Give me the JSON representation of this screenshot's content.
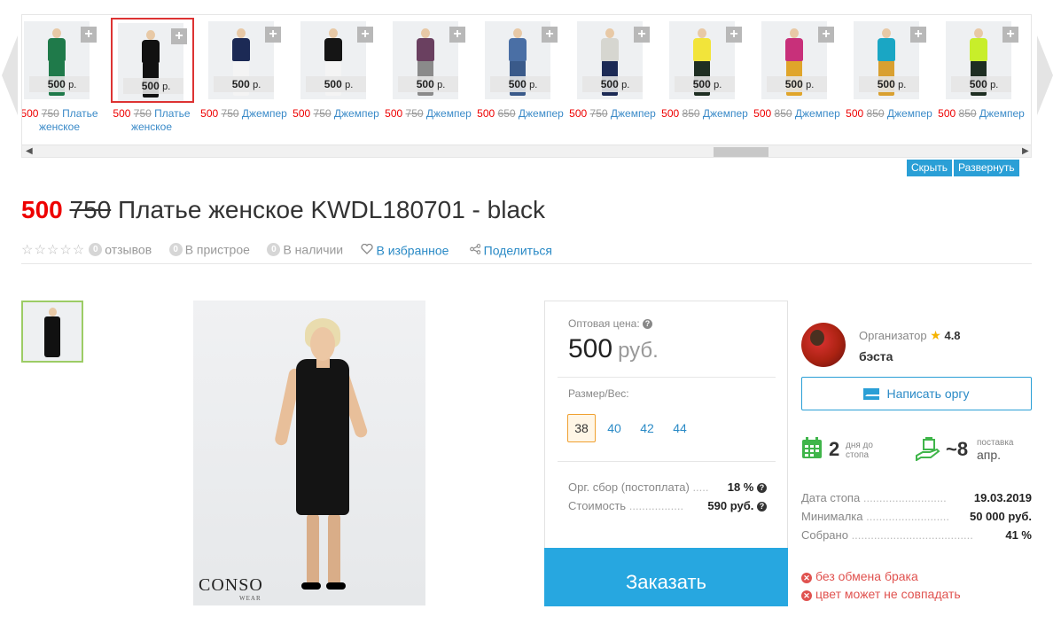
{
  "carousel": {
    "items": [
      {
        "price_tag": "500",
        "currency": "р.",
        "price_now": "500",
        "price_old": "750",
        "name": "Платье женское",
        "top_color": "#1f7a4a",
        "bottom_color": "#1f7a4a",
        "selected": false
      },
      {
        "price_tag": "500",
        "currency": "р.",
        "price_now": "500",
        "price_old": "750",
        "name": "Платье женское",
        "top_color": "#111111",
        "bottom_color": "#111111",
        "selected": true
      },
      {
        "price_tag": "500",
        "currency": "р.",
        "price_now": "500",
        "price_old": "750",
        "name": "Джемпер",
        "top_color": "#1c2a55",
        "bottom_color": "#f4f4f4",
        "selected": false
      },
      {
        "price_tag": "500",
        "currency": "р.",
        "price_now": "500",
        "price_old": "750",
        "name": "Джемпер",
        "top_color": "#151515",
        "bottom_color": "#f4f4f4",
        "selected": false
      },
      {
        "price_tag": "500",
        "currency": "р.",
        "price_now": "500",
        "price_old": "750",
        "name": "Джемпер",
        "top_color": "#6a4060",
        "bottom_color": "#8a8a8a",
        "selected": false
      },
      {
        "price_tag": "500",
        "currency": "р.",
        "price_now": "500",
        "price_old": "650",
        "name": "Джемпер",
        "top_color": "#4a6fa5",
        "bottom_color": "#3a5a8a",
        "selected": false
      },
      {
        "price_tag": "500",
        "currency": "р.",
        "price_now": "500",
        "price_old": "750",
        "name": "Джемпер",
        "top_color": "#d6d6d0",
        "bottom_color": "#1c2a55",
        "selected": false
      },
      {
        "price_tag": "500",
        "currency": "р.",
        "price_now": "500",
        "price_old": "850",
        "name": "Джемпер",
        "top_color": "#f2e43a",
        "bottom_color": "#1e2e22",
        "selected": false
      },
      {
        "price_tag": "500",
        "currency": "р.",
        "price_now": "500",
        "price_old": "850",
        "name": "Джемпер",
        "top_color": "#c8307a",
        "bottom_color": "#e0a52a",
        "selected": false
      },
      {
        "price_tag": "500",
        "currency": "р.",
        "price_now": "500",
        "price_old": "850",
        "name": "Джемпер",
        "top_color": "#1aa6c4",
        "bottom_color": "#d9a030",
        "selected": false
      },
      {
        "price_tag": "500",
        "currency": "р.",
        "price_now": "500",
        "price_old": "850",
        "name": "Джемпер",
        "top_color": "#c8ee2a",
        "bottom_color": "#1e2e22",
        "selected": false
      }
    ],
    "hide_label": "Скрыть",
    "expand_label": "Развернуть"
  },
  "product": {
    "price_now": "500",
    "price_old": "750",
    "title": "Платье женское KWDL180701 - black"
  },
  "meta": {
    "reviews_count": "0",
    "reviews_label": "отзывов",
    "attached_count": "0",
    "attached_label": "В пристрое",
    "stock_count": "0",
    "stock_label": "В наличии",
    "favorite_label": "В избранное",
    "share_label": "Поделиться"
  },
  "photo": {
    "brand": "CONSO",
    "brand_sub": "WEAR"
  },
  "panel": {
    "wholesale_label": "Оптовая цена:",
    "price": "500",
    "unit": "руб.",
    "size_label": "Размер/Вес:",
    "sizes": [
      "38",
      "40",
      "42",
      "44"
    ],
    "fee_label": "Орг. сбор (постоплата)",
    "fee_value": "18 %",
    "cost_label": "Стоимость",
    "cost_value": "590 руб.",
    "order_label": "Заказать"
  },
  "organizer": {
    "label": "Организатор",
    "rating": "4.8",
    "name": "бэста",
    "write_label": "Написать оргу",
    "days_num": "2",
    "days_cap_1": "дня до",
    "days_cap_2": "стопа",
    "delivery_num": "~8",
    "delivery_cap": "поставка",
    "delivery_month": "апр.",
    "stop_date_label": "Дата стопа",
    "stop_date_value": "19.03.2019",
    "min_label": "Минималка",
    "min_value": "50 000 руб.",
    "collected_label": "Собрано",
    "collected_value": "41 %",
    "warn_1": "без обмена брака",
    "warn_2": "цвет может не совпадать"
  },
  "colors": {
    "accent": "#2a9fd6",
    "price_red": "#e00000",
    "order_blue": "#27a7e0",
    "green_icon": "#3fb54a"
  }
}
